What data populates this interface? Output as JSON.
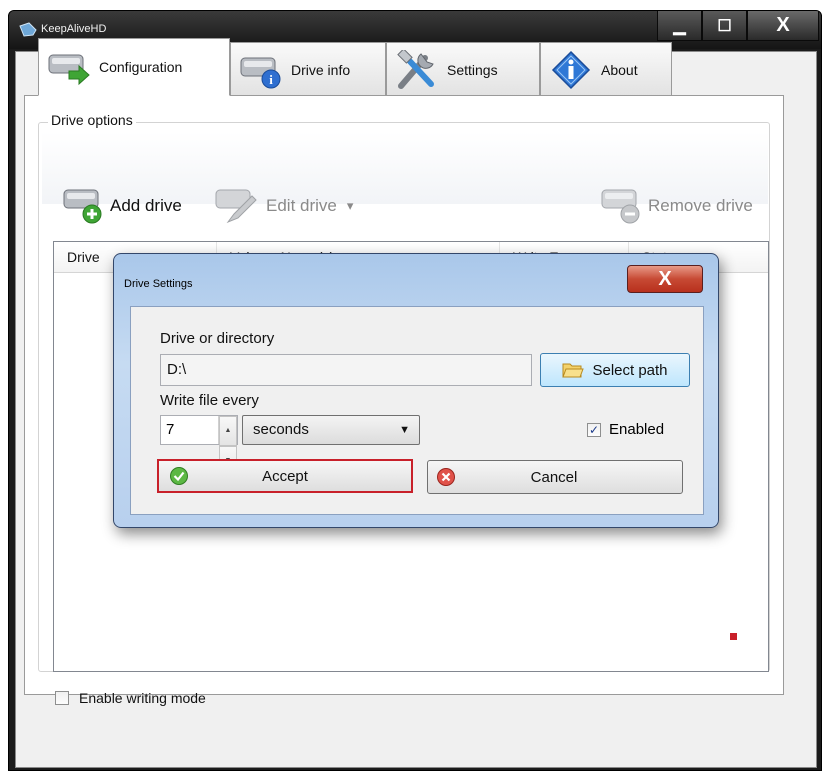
{
  "window": {
    "title": "KeepAliveHD",
    "minimize_glyph": "▁",
    "maximize_glyph": "☐",
    "close_glyph": "X"
  },
  "tabs": [
    {
      "label": "Configuration",
      "icon": "drive-arrow-icon",
      "active": true
    },
    {
      "label": "Drive info",
      "icon": "drive-info-icon",
      "active": false
    },
    {
      "label": "Settings",
      "icon": "tools-icon",
      "active": false
    },
    {
      "label": "About",
      "icon": "info-icon",
      "active": false
    }
  ],
  "drive_options": {
    "group_label": "Drive options",
    "add_drive": "Add drive",
    "edit_drive": "Edit drive",
    "edit_drive_arrow": "▾",
    "remove_drive": "Remove drive"
  },
  "list": {
    "columns": [
      "Drive",
      "Volume Name(s)",
      "Write Every",
      "Status"
    ]
  },
  "enable_writing": {
    "label": "Enable writing mode",
    "checked": false
  },
  "dialog": {
    "title": "Drive Settings",
    "close_glyph": "X",
    "drive_label": "Drive or directory",
    "drive_value": "D:\\",
    "select_path": "Select path",
    "write_label": "Write file every",
    "interval_value": "7",
    "unit_value": "seconds",
    "enabled_label": "Enabled",
    "enabled_checked": true,
    "accept": "Accept",
    "cancel": "Cancel"
  },
  "colors": {
    "accept_focus_border": "#c8202a",
    "dialog_frame": "#b8d0ee"
  }
}
